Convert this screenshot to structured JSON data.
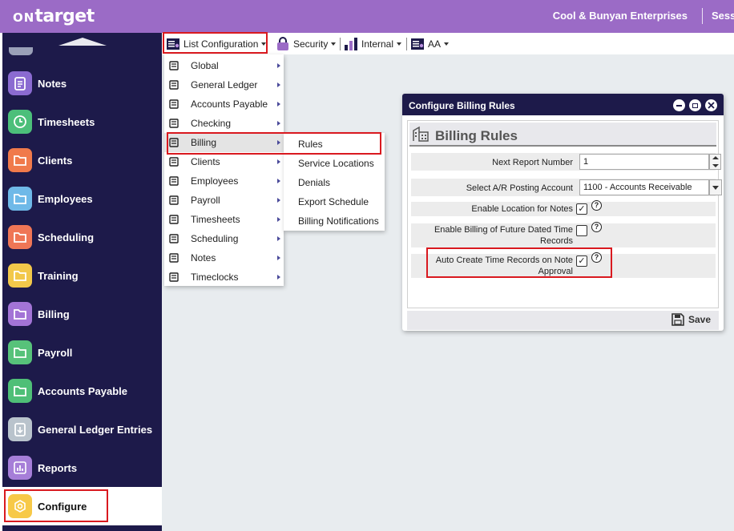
{
  "header": {
    "logo_prefix": "ON",
    "logo_main": "target",
    "company": "Cool & Bunyan Enterprises",
    "session_partial": "Sess"
  },
  "sidebar": {
    "items": [
      {
        "label": "Notes",
        "icon": "notes-icon",
        "color": "#8b6bd1"
      },
      {
        "label": "Timesheets",
        "icon": "clock-icon",
        "color": "#4cbf7a"
      },
      {
        "label": "Clients",
        "icon": "folder-icon",
        "color": "#f07a4b"
      },
      {
        "label": "Employees",
        "icon": "folder-icon",
        "color": "#6fb9e8"
      },
      {
        "label": "Scheduling",
        "icon": "calendar-icon",
        "color": "#ef7656"
      },
      {
        "label": "Training",
        "icon": "folder-icon",
        "color": "#f2c84a"
      },
      {
        "label": "Billing",
        "icon": "folder-icon",
        "color": "#a374d6"
      },
      {
        "label": "Payroll",
        "icon": "folder-icon",
        "color": "#57c27a"
      },
      {
        "label": "Accounts Payable",
        "icon": "folder-icon",
        "color": "#4fbf77"
      },
      {
        "label": "General Ledger Entries",
        "icon": "download-doc-icon",
        "color": "#b9c3cc"
      },
      {
        "label": "Reports",
        "icon": "bar-chart-icon",
        "color": "#a67ed8"
      },
      {
        "label": "Configure",
        "icon": "hexagon-gear-icon",
        "color": "#f7c948"
      }
    ]
  },
  "toolbar": {
    "list_config": "List Configuration",
    "security": "Security",
    "internal": "Internal",
    "aa": "AA"
  },
  "menu": {
    "items": [
      "Global",
      "General Ledger",
      "Accounts Payable",
      "Checking",
      "Billing",
      "Clients",
      "Employees",
      "Payroll",
      "Timesheets",
      "Scheduling",
      "Notes",
      "Timeclocks"
    ]
  },
  "submenu": {
    "items": [
      "Rules",
      "Service Locations",
      "Denials",
      "Export Schedule",
      "Billing Notifications"
    ]
  },
  "dialog": {
    "title": "Configure Billing Rules",
    "section": "Billing Rules",
    "next_report_label": "Next Report Number",
    "next_report_value": "1",
    "ar_label": "Select A/R Posting Account",
    "ar_value": "1100 - Accounts Receivable",
    "enable_location_label": "Enable Location for Notes",
    "enable_location_checked": "✓",
    "future_line1": "Enable Billing of Future Dated Time",
    "future_line2": "Records",
    "auto_line1": "Auto Create Time Records on Note",
    "auto_line2": "Approval",
    "auto_checked": "✓",
    "help": "?",
    "save": "Save"
  },
  "colors": {
    "header": "#9b6bc6",
    "sidebar": "#1d1a4a",
    "highlight": "#d9191f"
  }
}
